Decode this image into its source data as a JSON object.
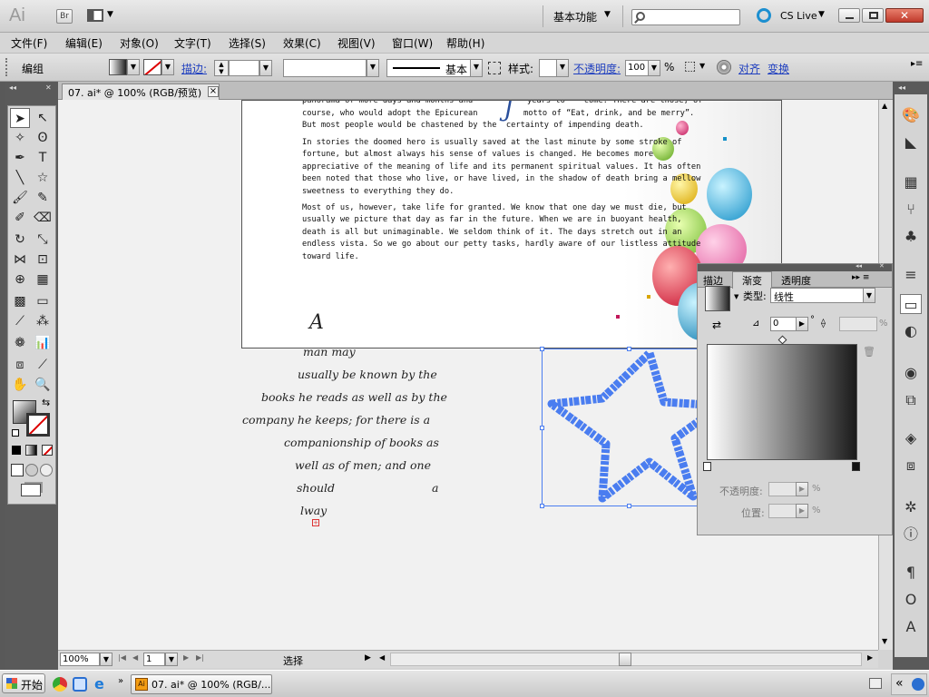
{
  "titlebar": {
    "app_logo": "Ai",
    "bridge_button": "Br",
    "workspace_label": "基本功能",
    "cslive_label": "CS Live",
    "search_placeholder": ""
  },
  "menu": [
    "文件(F)",
    "编辑(E)",
    "对象(O)",
    "文字(T)",
    "选择(S)",
    "效果(C)",
    "视图(V)",
    "窗口(W)",
    "帮助(H)"
  ],
  "control_bar": {
    "selection_label": "编组",
    "stroke_label": "描边:",
    "stroke_profile_label": "基本",
    "style_label": "样式:",
    "opacity_label": "不透明度:",
    "opacity_value": "100",
    "opacity_unit": "%",
    "align_label": "对齐",
    "transform_label": "变换"
  },
  "document_tab": {
    "title": "07. ai* @ 100% (RGB/预览)",
    "close": "×"
  },
  "artboard": {
    "para1_lines": [
      "panorama of more days and months and",
      "course, who would adopt the Epicurean",
      "But most people would be chastened by the  certainty of impending death."
    ],
    "para1_right_lines": [
      "years to    come. There are those, of",
      "motto of “Eat, drink, and be merry”."
    ],
    "para2_lines": [
      "In stories the doomed hero is usually saved at the last minute by some stroke of",
      "fortune, but almost always his sense of values is changed. He becomes more",
      "appreciative of the meaning of life and its permanent spiritual values. It has often",
      "been noted that those who live, or have lived, in the shadow of death bring a mellow",
      "sweetness to everything they do."
    ],
    "para3_lines": [
      "Most of us, however, take life for granted. We know that one day we must die, but",
      "usually we picture that day as far in the future. When we are in buoyant health,",
      "death is all but unimaginable. We seldom think of it. The days stretch out in an",
      "endless vista. So we go about our petty tasks, hardly aware of our listless attitude",
      "toward life."
    ],
    "script_initial": "A"
  },
  "script_text_lines": [
    "man may",
    "usually be known by the",
    "books he reads as well as by the",
    "company he keeps; for there is a",
    "companionship of books as",
    "well as of men; and one",
    "should",
    "a",
    "lway"
  ],
  "gradient_panel": {
    "tabs": [
      "描边",
      "渐变",
      "透明度"
    ],
    "type_label": "类型:",
    "type_value": "线性",
    "angle_value": "0",
    "angle_unit": "°",
    "aspect_unit": "%",
    "opacity_label": "不透明度:",
    "opacity_unit": "%",
    "location_label": "位置:",
    "location_unit": "%",
    "gradient_start": "#ffffff",
    "gradient_end": "#1a1a1a"
  },
  "statusbar": {
    "zoom": "100%",
    "page": "1",
    "status_label": "选择"
  },
  "taskbar": {
    "start_label": "开始",
    "task_label": "07. ai* @ 100% (RGB/...",
    "tray_label": "«"
  },
  "colors": {
    "star_selection": "#4a7df0",
    "selection_box": "#4a7df0",
    "menu_link_blue": "#1f3fbf"
  }
}
